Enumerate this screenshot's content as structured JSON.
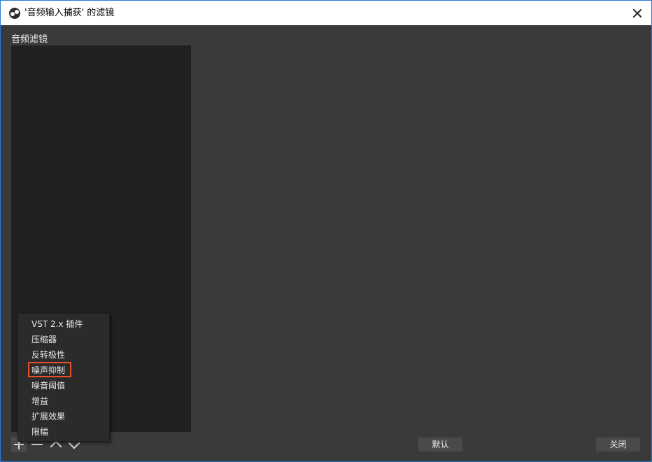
{
  "window": {
    "title": "'音频输入捕获' 的滤镜"
  },
  "panel": {
    "label": "音频滤镜"
  },
  "menu": {
    "items": [
      "VST 2.x 插件",
      "压缩器",
      "反转极性",
      "噪声抑制",
      "噪音阈值",
      "增益",
      "扩展效果",
      "限幅"
    ],
    "highlighted_index": 3,
    "highlight_color": "#e5522a"
  },
  "buttons": {
    "default": "默认",
    "close": "关闭"
  },
  "icons": {
    "app": "obs-logo-icon",
    "close": "close-icon",
    "add": "plus-icon",
    "remove": "minus-icon",
    "up": "chevron-up-icon",
    "down": "chevron-down-icon"
  }
}
